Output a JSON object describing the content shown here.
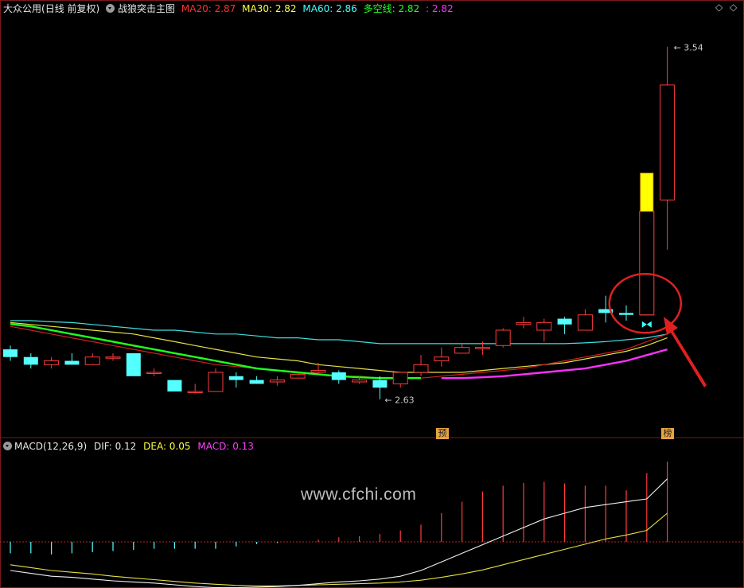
{
  "header": {
    "stock": "大众公用",
    "period": "(日线 前复权)",
    "indicator": "战狼突击主图",
    "ma20": "MA20: 2.87",
    "ma30": "MA30: 2.82",
    "ma60": "MA60: 2.86",
    "duokong_label": "多空线: 2.82",
    "duokong_value2": ": 2.82",
    "colors": {
      "ma20": "#ff3030",
      "ma30": "#ffff40",
      "ma60": "#40ffff",
      "duokong": "#20ff20",
      "duokong2": "#ff30ff"
    }
  },
  "macd_header": {
    "name": "MACD(12,26,9)",
    "dif": "DIF: 0.12",
    "dea": "DEA: 0.05",
    "macd": "MACD: 0.13"
  },
  "watermark": "www.cfchi.com",
  "markers": {
    "pre": "预",
    "bang": "榜"
  },
  "annotations": {
    "high": "3.54",
    "low": "2.63"
  },
  "chart_data": [
    {
      "type": "candlestick",
      "ylim": [
        2.54,
        3.62
      ],
      "candles": [
        {
          "o": 2.76,
          "c": 2.74,
          "h": 2.77,
          "l": 2.73
        },
        {
          "o": 2.74,
          "c": 2.72,
          "h": 2.75,
          "l": 2.71
        },
        {
          "o": 2.72,
          "c": 2.73,
          "h": 2.74,
          "l": 2.71
        },
        {
          "o": 2.73,
          "c": 2.72,
          "h": 2.75,
          "l": 2.72
        },
        {
          "o": 2.72,
          "c": 2.74,
          "h": 2.75,
          "l": 2.72
        },
        {
          "o": 2.74,
          "c": 2.74,
          "h": 2.75,
          "l": 2.73
        },
        {
          "o": 2.75,
          "c": 2.69,
          "h": 2.75,
          "l": 2.69
        },
        {
          "o": 2.7,
          "c": 2.7,
          "h": 2.71,
          "l": 2.69
        },
        {
          "o": 2.68,
          "c": 2.65,
          "h": 2.68,
          "l": 2.65
        },
        {
          "o": 2.65,
          "c": 2.65,
          "h": 2.67,
          "l": 2.645
        },
        {
          "o": 2.65,
          "c": 2.7,
          "h": 2.71,
          "l": 2.65
        },
        {
          "o": 2.69,
          "c": 2.68,
          "h": 2.7,
          "l": 2.66
        },
        {
          "o": 2.68,
          "c": 2.67,
          "h": 2.69,
          "l": 2.67
        },
        {
          "o": 2.675,
          "c": 2.68,
          "h": 2.69,
          "l": 2.665
        },
        {
          "o": 2.685,
          "c": 2.695,
          "h": 2.7,
          "l": 2.685
        },
        {
          "o": 2.7,
          "c": 2.705,
          "h": 2.725,
          "l": 2.695
        },
        {
          "o": 2.7,
          "c": 2.68,
          "h": 2.705,
          "l": 2.67
        },
        {
          "o": 2.675,
          "c": 2.68,
          "h": 2.69,
          "l": 2.67
        },
        {
          "o": 2.68,
          "c": 2.66,
          "h": 2.69,
          "l": 2.63
        },
        {
          "o": 2.67,
          "c": 2.7,
          "h": 2.7,
          "l": 2.66
        },
        {
          "o": 2.7,
          "c": 2.72,
          "h": 2.745,
          "l": 2.69
        },
        {
          "o": 2.73,
          "c": 2.74,
          "h": 2.765,
          "l": 2.715
        },
        {
          "o": 2.75,
          "c": 2.765,
          "h": 2.775,
          "l": 2.75
        },
        {
          "o": 2.765,
          "c": 2.765,
          "h": 2.78,
          "l": 2.745
        },
        {
          "o": 2.77,
          "c": 2.81,
          "h": 2.815,
          "l": 2.765
        },
        {
          "o": 2.825,
          "c": 2.83,
          "h": 2.845,
          "l": 2.815
        },
        {
          "o": 2.81,
          "c": 2.83,
          "h": 2.84,
          "l": 2.78
        },
        {
          "o": 2.84,
          "c": 2.825,
          "h": 2.845,
          "l": 2.8
        },
        {
          "o": 2.81,
          "c": 2.85,
          "h": 2.865,
          "l": 2.81
        },
        {
          "o": 2.865,
          "c": 2.855,
          "h": 2.9,
          "l": 2.83
        },
        {
          "o": 2.855,
          "c": 2.85,
          "h": 2.875,
          "l": 2.835
        },
        {
          "o": 2.85,
          "c": 3.12,
          "h": 3.12,
          "l": 2.85
        },
        {
          "o": 3.15,
          "c": 3.45,
          "h": 3.55,
          "l": 3.02
        }
      ],
      "ma20": [
        2.82,
        2.81,
        2.8,
        2.79,
        2.78,
        2.77,
        2.76,
        2.75,
        2.74,
        2.73,
        2.72,
        2.715,
        2.71,
        2.705,
        2.7,
        2.695,
        2.69,
        2.69,
        2.685,
        2.685,
        2.685,
        2.69,
        2.695,
        2.7,
        2.705,
        2.71,
        2.72,
        2.73,
        2.74,
        2.75,
        2.76,
        2.78,
        2.8
      ],
      "ma30": [
        2.83,
        2.825,
        2.82,
        2.815,
        2.81,
        2.805,
        2.8,
        2.79,
        2.78,
        2.77,
        2.76,
        2.75,
        2.74,
        2.735,
        2.73,
        2.72,
        2.715,
        2.71,
        2.705,
        2.7,
        2.7,
        2.7,
        2.7,
        2.705,
        2.71,
        2.715,
        2.72,
        2.725,
        2.735,
        2.745,
        2.755,
        2.77,
        2.79
      ],
      "ma60": [
        2.835,
        2.835,
        2.832,
        2.83,
        2.825,
        2.82,
        2.815,
        2.81,
        2.81,
        2.805,
        2.8,
        2.8,
        2.795,
        2.79,
        2.79,
        2.785,
        2.785,
        2.78,
        2.775,
        2.775,
        2.775,
        2.775,
        2.775,
        2.775,
        2.775,
        2.775,
        2.775,
        2.775,
        2.777,
        2.78,
        2.785,
        2.79,
        2.8
      ],
      "duokong": [
        2.826,
        2.82,
        2.81,
        2.8,
        2.79,
        2.78,
        2.77,
        2.76,
        2.75,
        2.74,
        2.73,
        2.72,
        2.71,
        2.705,
        2.7,
        2.695,
        2.69,
        2.687,
        2.685,
        2.685,
        2.685,
        null,
        null,
        null,
        null,
        null,
        null,
        null,
        null,
        null,
        null,
        null,
        null
      ],
      "duokong2": [
        null,
        null,
        null,
        null,
        null,
        null,
        null,
        null,
        null,
        null,
        null,
        null,
        null,
        null,
        null,
        null,
        null,
        null,
        null,
        null,
        null,
        2.685,
        2.685,
        2.687,
        2.69,
        2.695,
        2.7,
        2.705,
        2.71,
        2.72,
        2.73,
        2.745,
        2.76
      ],
      "yellow_bar": {
        "index": 31,
        "from": 2.85,
        "to": 3.22
      }
    },
    {
      "type": "bar",
      "name": "MACD",
      "dif": [
        -0.05,
        -0.055,
        -0.06,
        -0.062,
        -0.065,
        -0.068,
        -0.07,
        -0.072,
        -0.075,
        -0.078,
        -0.08,
        -0.08,
        -0.079,
        -0.078,
        -0.076,
        -0.073,
        -0.07,
        -0.068,
        -0.065,
        -0.06,
        -0.05,
        -0.035,
        -0.02,
        -0.005,
        0.01,
        0.025,
        0.04,
        0.05,
        0.06,
        0.065,
        0.07,
        0.075,
        0.11
      ],
      "dea": [
        -0.04,
        -0.045,
        -0.05,
        -0.053,
        -0.056,
        -0.06,
        -0.063,
        -0.066,
        -0.069,
        -0.072,
        -0.074,
        -0.076,
        -0.077,
        -0.077,
        -0.076,
        -0.075,
        -0.074,
        -0.073,
        -0.072,
        -0.07,
        -0.067,
        -0.062,
        -0.056,
        -0.049,
        -0.04,
        -0.031,
        -0.022,
        -0.013,
        -0.004,
        0.005,
        0.012,
        0.02,
        0.05
      ],
      "hist": [
        -0.02,
        -0.02,
        -0.022,
        -0.02,
        -0.018,
        -0.016,
        -0.014,
        -0.012,
        -0.012,
        -0.012,
        -0.012,
        -0.008,
        -0.004,
        -0.002,
        0.0,
        0.004,
        0.008,
        0.01,
        0.014,
        0.02,
        0.03,
        0.05,
        0.07,
        0.088,
        0.098,
        0.103,
        0.105,
        0.102,
        0.098,
        0.098,
        0.09,
        0.12,
        0.14
      ]
    }
  ]
}
